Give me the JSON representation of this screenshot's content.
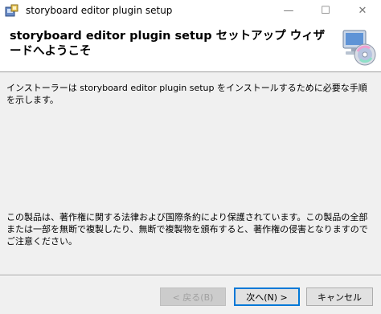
{
  "window": {
    "title": "storyboard editor plugin setup",
    "icon": "installer-app-icon",
    "controls": {
      "minimize": "—",
      "maximize": "☐",
      "close": "✕"
    }
  },
  "header": {
    "title": "storyboard editor plugin setup セットアップ ウィザードへようこそ",
    "icon": "setup-disc-icon"
  },
  "content": {
    "intro": "インストーラーは storyboard editor plugin setup をインストールするために必要な手順を示します。",
    "copyright": "この製品は、著作権に関する法律および国際条約により保護されています。この製品の全部または一部を無断で複製したり、無断で複製物を頒布すると、著作権の侵害となりますのでご注意ください。"
  },
  "buttons": {
    "back": "< 戻る(B)",
    "next": "次へ(N) >",
    "cancel": "キャンセル"
  },
  "colors": {
    "content_bg": "#f0f0f0",
    "default_button_border": "#0078d7"
  }
}
